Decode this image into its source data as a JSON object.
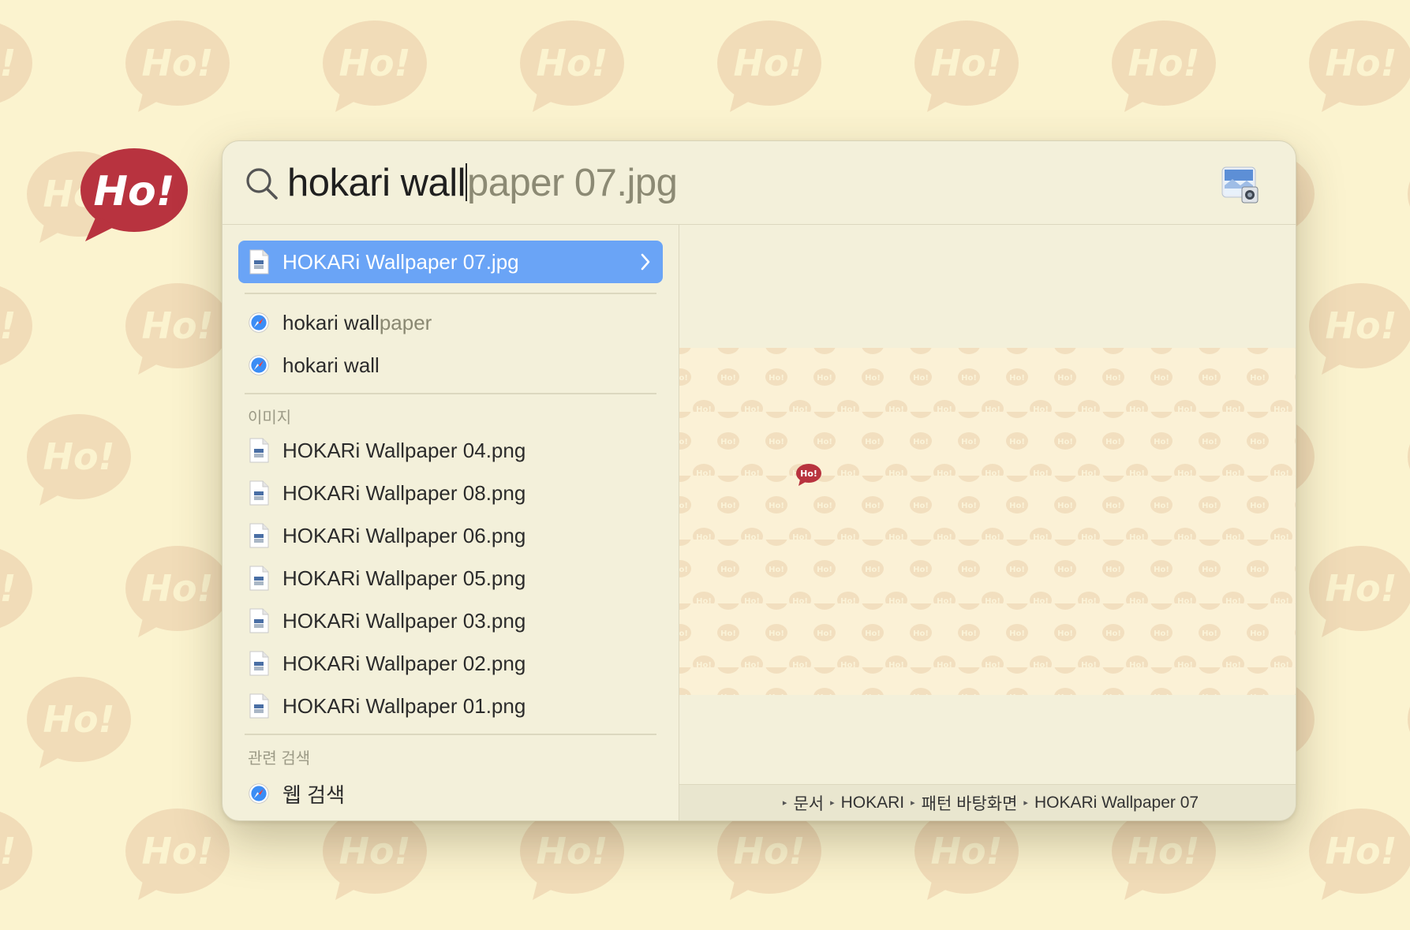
{
  "desktop": {
    "logo_text": "Ho!"
  },
  "search": {
    "typed": "hokari wall",
    "completion": "paper 07.jpg"
  },
  "results": {
    "top_hit": {
      "label": "HOKARi Wallpaper 07.jpg",
      "icon": "image-file-icon"
    },
    "suggestions": [
      {
        "typed": "hokari wall",
        "hint": "paper",
        "icon": "safari-icon"
      },
      {
        "typed": "hokari wall",
        "hint": "",
        "icon": "safari-icon"
      }
    ],
    "images_header": "이미지",
    "images": [
      "HOKARi Wallpaper 04.png",
      "HOKARi Wallpaper 08.png",
      "HOKARi Wallpaper 06.png",
      "HOKARi Wallpaper 05.png",
      "HOKARi Wallpaper 03.png",
      "HOKARi Wallpaper 02.png",
      "HOKARi Wallpaper 01.png"
    ],
    "related_header": "관련 검색",
    "web_search": {
      "label": "웹 검색",
      "icon": "safari-icon"
    }
  },
  "preview": {
    "path": [
      "문서",
      "HOKARI",
      "패턴 바탕화면",
      "HOKARi Wallpaper 07"
    ],
    "image_logo_text": "Ho!"
  },
  "colors": {
    "background": "#fbf3cf",
    "logo_red": "#b8333f",
    "selection": "#6aa4f6",
    "panel": "#f3f0da"
  }
}
